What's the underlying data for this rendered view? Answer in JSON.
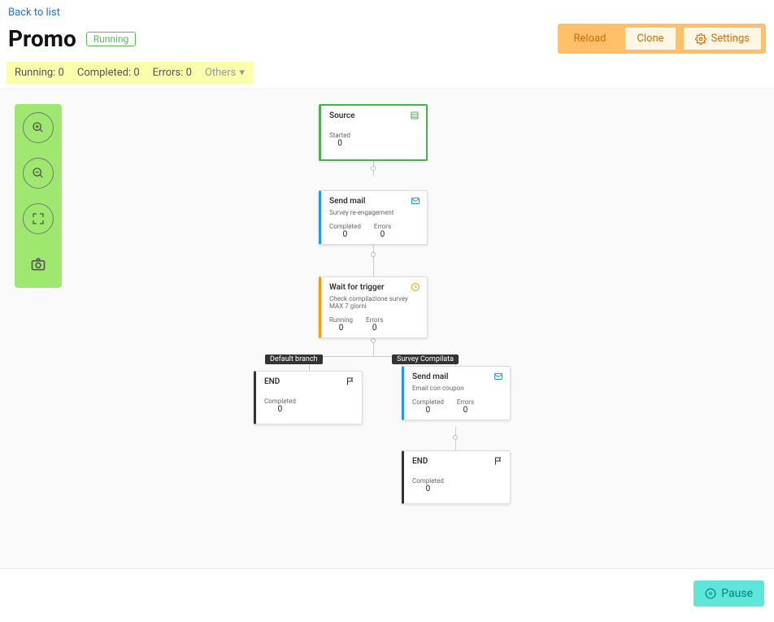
{
  "back_link": "Back to list",
  "title": "Promo",
  "status_pill": "Running",
  "actions": {
    "reload": "Reload",
    "clone": "Clone",
    "settings": "Settings"
  },
  "stats": {
    "running": "Running: 0",
    "completed": "Completed: 0",
    "errors": "Errors: 0",
    "others": "Others"
  },
  "nodes": {
    "source": {
      "title": "Source",
      "stat1_label": "Started",
      "stat1_value": "0"
    },
    "mail1": {
      "title": "Send mail",
      "subtitle": "Survey re-engagement",
      "stat1_label": "Completed",
      "stat1_value": "0",
      "stat2_label": "Errors",
      "stat2_value": "0"
    },
    "wait": {
      "title": "Wait for trigger",
      "subtitle": "Check compilazione survey MAX 7 giorni",
      "stat1_label": "Running",
      "stat1_value": "0",
      "stat2_label": "Errors",
      "stat2_value": "0"
    },
    "end1": {
      "title": "END",
      "stat1_label": "Completed",
      "stat1_value": "0"
    },
    "mail2": {
      "title": "Send mail",
      "subtitle": "Email con coupon",
      "stat1_label": "Completed",
      "stat1_value": "0",
      "stat2_label": "Errors",
      "stat2_value": "0"
    },
    "end2": {
      "title": "END",
      "stat1_label": "Completed",
      "stat1_value": "0"
    }
  },
  "branch_labels": {
    "default": "Default branch",
    "survey": "Survey Compilata"
  },
  "pause": "Pause"
}
